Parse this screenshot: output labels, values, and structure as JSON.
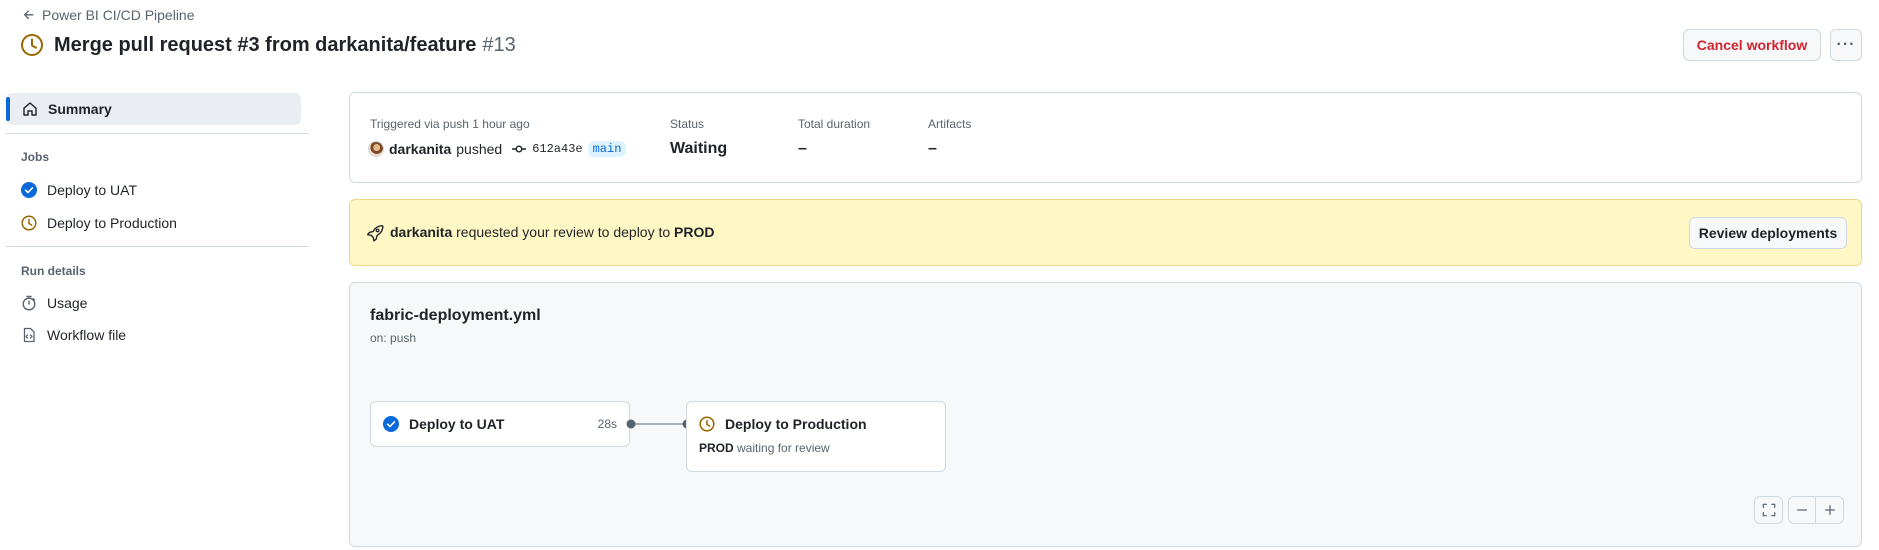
{
  "header": {
    "back_label": "Power BI CI/CD Pipeline",
    "title": "Merge pull request #3 from darkanita/feature",
    "run_number": "#13",
    "cancel_label": "Cancel workflow",
    "more_label": "···"
  },
  "sidebar": {
    "summary_label": "Summary",
    "jobs_heading": "Jobs",
    "jobs": [
      {
        "label": "Deploy to UAT",
        "status": "success"
      },
      {
        "label": "Deploy to Production",
        "status": "waiting"
      }
    ],
    "run_details_heading": "Run details",
    "run_details": [
      {
        "label": "Usage",
        "icon": "stopwatch-icon"
      },
      {
        "label": "Workflow file",
        "icon": "file-code-icon"
      }
    ]
  },
  "summary": {
    "trigger_text": "Triggered via push 1 hour ago",
    "actor": "darkanita",
    "pushed_text": "pushed",
    "commit_sha": "612a43e",
    "branch": "main",
    "status_label": "Status",
    "status_value": "Waiting",
    "duration_label": "Total duration",
    "duration_value": "–",
    "artifacts_label": "Artifacts",
    "artifacts_value": "–"
  },
  "review": {
    "actor": "darkanita",
    "message": "requested your review to deploy to",
    "environment": "PROD",
    "button_label": "Review deployments"
  },
  "workflow": {
    "file_name": "fabric-deployment.yml",
    "trigger": "on: push",
    "jobs": [
      {
        "name": "Deploy to UAT",
        "duration": "28s",
        "status": "success"
      },
      {
        "name": "Deploy to Production",
        "environment": "PROD",
        "detail": "waiting for review",
        "status": "waiting"
      }
    ]
  },
  "colors": {
    "accent": "#0969da",
    "waiting": "#9a6700",
    "danger": "#d1242f",
    "banner": "#fff8c5"
  }
}
